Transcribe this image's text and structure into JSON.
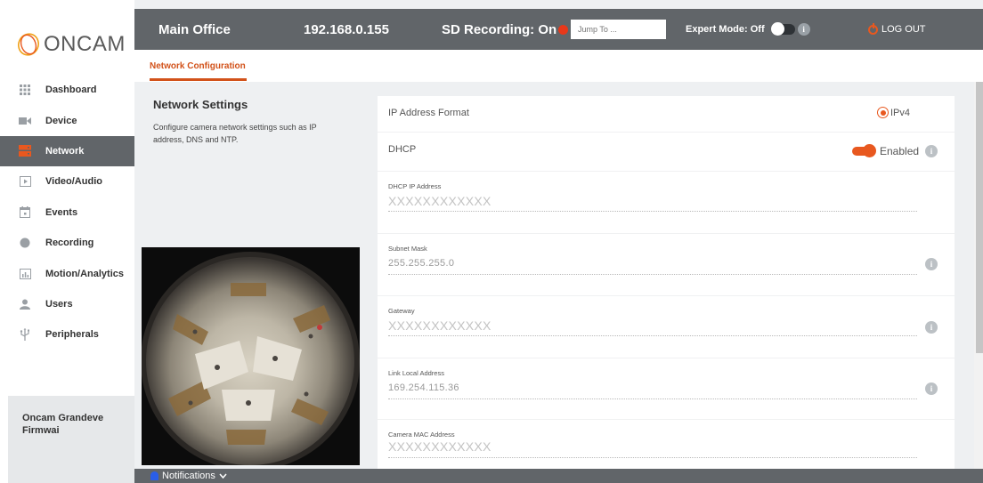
{
  "app": {
    "logo_text": "ONCAM"
  },
  "sidebar": {
    "items": [
      {
        "label": "Dashboard",
        "icon": "grid-icon"
      },
      {
        "label": "Device",
        "icon": "camera-icon"
      },
      {
        "label": "Network",
        "icon": "network-icon",
        "active": true
      },
      {
        "label": "Video/Audio",
        "icon": "play-icon"
      },
      {
        "label": "Events",
        "icon": "calendar-icon"
      },
      {
        "label": "Recording",
        "icon": "record-icon"
      },
      {
        "label": "Motion/Analytics",
        "icon": "bar-chart-icon"
      },
      {
        "label": "Users",
        "icon": "user-icon"
      },
      {
        "label": "Peripherals",
        "icon": "usb-icon"
      }
    ],
    "firmware_line1": "Oncam Grandeve",
    "firmware_line2": "Firmwai"
  },
  "topbar": {
    "title": "Main Office",
    "ip": "192.168.0.155",
    "sd_recording": "SD Recording: On",
    "jump_placeholder": "Jump To ...",
    "expert_mode": "Expert Mode: Off",
    "info_glyph": "i",
    "logout": "LOG OUT"
  },
  "tabs": {
    "active": "Network Configuration"
  },
  "section": {
    "title": "Network Settings",
    "description": "Configure camera network settings such as IP address, DNS and NTP."
  },
  "form": {
    "ip_format": {
      "label": "IP Address Format",
      "value": "IPv4"
    },
    "dhcp": {
      "label": "DHCP",
      "state": "Enabled"
    },
    "dhcp_ip": {
      "label": "DHCP IP Address",
      "value": "XXXXXXXXXXXX"
    },
    "subnet": {
      "label": "Subnet Mask",
      "value": "255.255.255.0"
    },
    "gateway": {
      "label": "Gateway",
      "value": "XXXXXXXXXXXX"
    },
    "link_local": {
      "label": "Link Local Address",
      "value": "169.254.115.36"
    },
    "mac": {
      "label": "Camera MAC Address",
      "value": "XXXXXXXXXXXX"
    }
  },
  "notifications": {
    "label": "Notifications"
  },
  "colors": {
    "accent": "#e8581f",
    "topbar": "#616569"
  }
}
